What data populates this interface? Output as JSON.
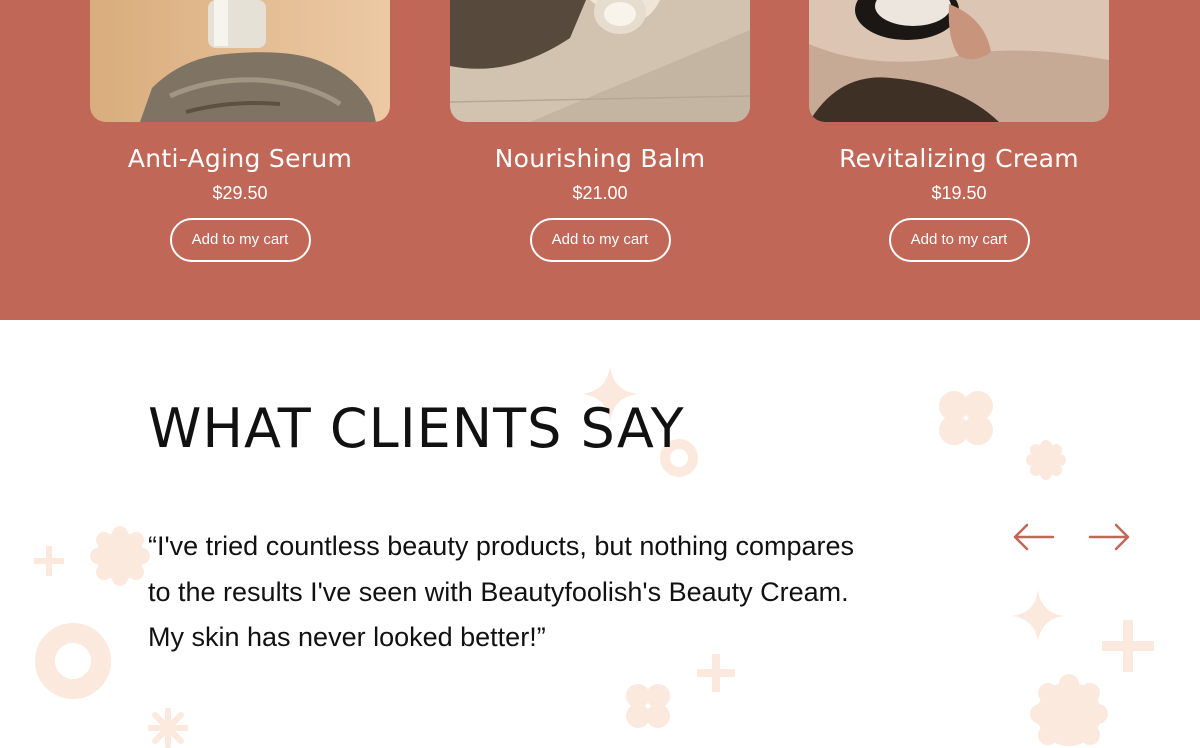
{
  "products": [
    {
      "title": "Anti-Aging Serum",
      "price": "$29.50",
      "button": "Add to my cart"
    },
    {
      "title": "Nourishing Balm",
      "price": "$21.00",
      "button": "Add to my cart"
    },
    {
      "title": "Revitalizing Cream",
      "price": "$19.50",
      "button": "Add to my cart"
    }
  ],
  "testimonials": {
    "heading": "WHAT CLIENTS SAY",
    "quote": "“I've tried countless beauty products, but nothing compares to the results I've seen with Beautyfoolish's Beauty Cream. My skin has never looked better!”"
  },
  "colors": {
    "brand": "#c16757",
    "decoration": "#fce9de"
  },
  "icons": [
    "arrow-left-icon",
    "arrow-right-icon"
  ]
}
